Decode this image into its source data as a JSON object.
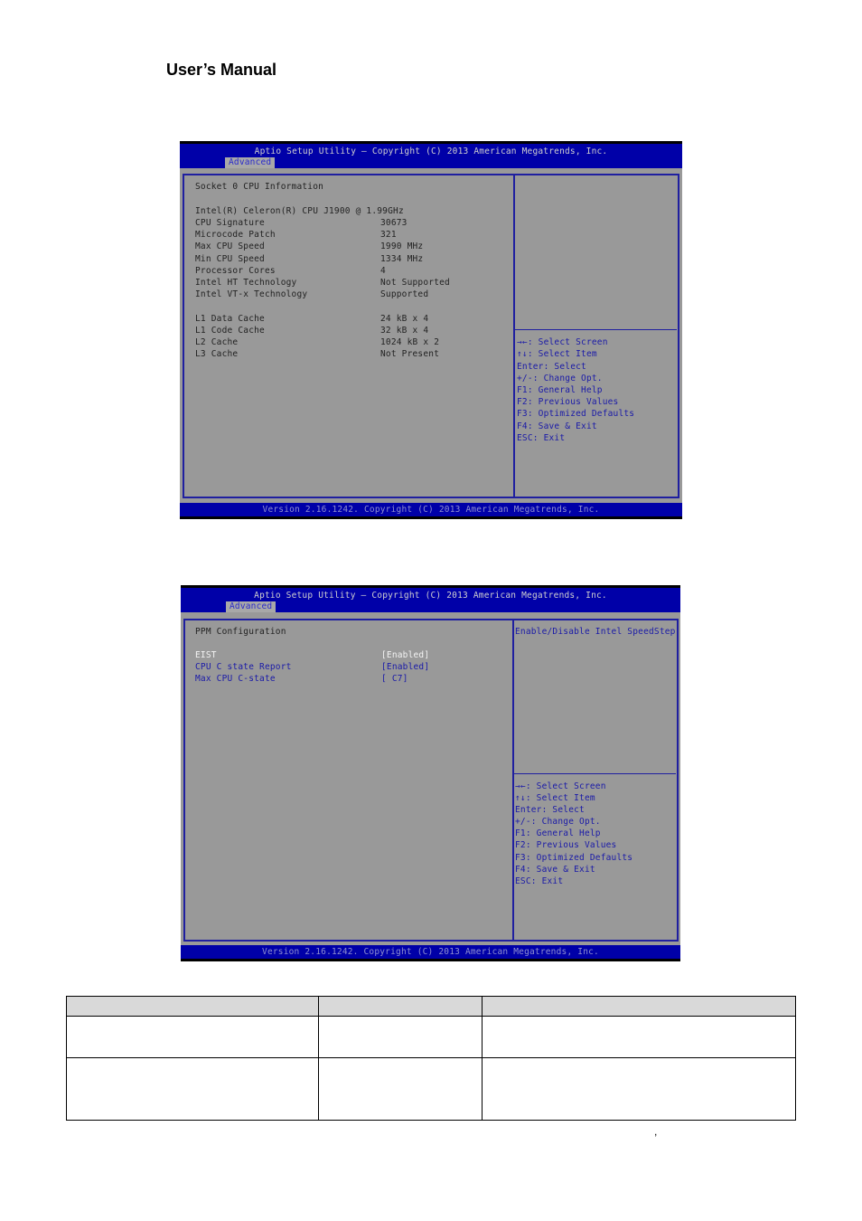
{
  "document": {
    "header_title": "User’s Manual",
    "stray_mark": ","
  },
  "bios_screens": [
    {
      "title": "Aptio Setup Utility – Copyright (C) 2013 American Megatrends, Inc.",
      "active_tab": "Advanced",
      "section_heading": "Socket 0 CPU Information",
      "processor_name": "Intel(R) Celeron(R) CPU J1900 @ 1.99GHz",
      "rows": [
        {
          "label": "CPU Signature",
          "value": "30673"
        },
        {
          "label": "Microcode Patch",
          "value": "321"
        },
        {
          "label": "Max CPU Speed",
          "value": "1990 MHz"
        },
        {
          "label": "Min CPU Speed",
          "value": "1334 MHz"
        },
        {
          "label": "Processor Cores",
          "value": "4"
        },
        {
          "label": "Intel HT Technology",
          "value": "Not Supported"
        },
        {
          "label": "Intel VT-x Technology",
          "value": "Supported"
        }
      ],
      "cache_rows": [
        {
          "label": "L1 Data Cache",
          "value": "24 kB x 4"
        },
        {
          "label": "L1 Code Cache",
          "value": "32 kB x 4"
        },
        {
          "label": "L2 Cache",
          "value": "1024 kB x 2"
        },
        {
          "label": "L3 Cache",
          "value": "Not Present"
        }
      ],
      "help_text": "",
      "key_help": [
        "→←: Select Screen",
        "↑↓: Select Item",
        "Enter: Select",
        "+/-: Change Opt.",
        "F1: General Help",
        "F2: Previous Values",
        "F3: Optimized Defaults",
        "F4: Save & Exit",
        "ESC: Exit"
      ],
      "footer": "Version 2.16.1242. Copyright (C) 2013 American Megatrends, Inc."
    },
    {
      "title": "Aptio Setup Utility – Copyright (C) 2013 American Megatrends, Inc.",
      "active_tab": "Advanced",
      "section_heading": "PPM Configuration",
      "options": [
        {
          "label": "EIST",
          "value": "[Enabled]",
          "selected": true
        },
        {
          "label": "CPU C state Report",
          "value": "[Enabled]",
          "selected": false
        },
        {
          "label": "Max CPU C-state",
          "value": "[ C7]",
          "selected": false
        }
      ],
      "help_text": "Enable/Disable Intel SpeedStep",
      "key_help": [
        "→←: Select Screen",
        "↑↓: Select Item",
        "Enter: Select",
        "+/-: Change Opt.",
        "F1: General Help",
        "F2: Previous Values",
        "F3: Optimized Defaults",
        "F4: Save & Exit",
        "ESC: Exit"
      ],
      "footer": "Version 2.16.1242. Copyright (C) 2013 American Megatrends, Inc."
    }
  ],
  "options_table": {
    "headers": [
      "",
      "",
      ""
    ],
    "rows": [
      [
        "",
        "",
        ""
      ],
      [
        "",
        "",
        ""
      ]
    ]
  }
}
